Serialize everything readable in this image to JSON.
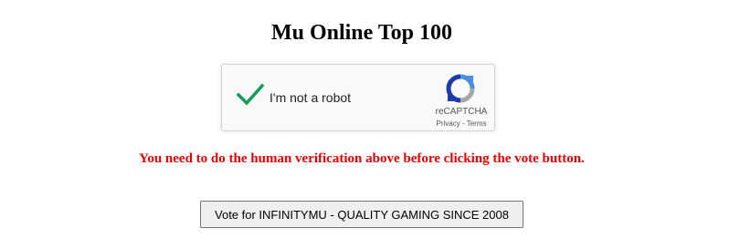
{
  "page": {
    "title": "Mu Online Top 100"
  },
  "captcha": {
    "label": "I'm not a robot",
    "checked": true,
    "brand": "reCAPTCHA",
    "privacy_link": "Privacy",
    "separator": " - ",
    "terms_link": "Terms",
    "icons": {
      "check": "checkmark-icon",
      "logo": "recaptcha-logo-icon"
    },
    "colors": {
      "check": "#0f9d58",
      "logo_blue": "#4a90e2",
      "logo_dark": "#1c3aa9",
      "logo_gray": "#a6a6a6"
    }
  },
  "warning": {
    "text": "You need to do the human verification above before clicking the vote button.",
    "color": "#ee0000"
  },
  "vote": {
    "button_label": "Vote for INFINITYMU - QUALITY GAMING SINCE 2008"
  }
}
